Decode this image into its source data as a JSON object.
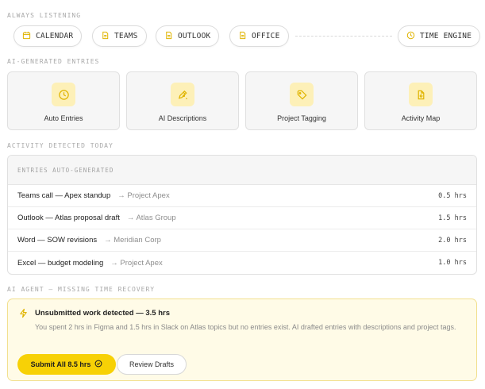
{
  "listening": {
    "label": "ALWAYS LISTENING",
    "chips": [
      {
        "label": "CALENDAR",
        "icon": "calendar-icon"
      },
      {
        "label": "TEAMS",
        "icon": "document-icon"
      },
      {
        "label": "OUTLOOK",
        "icon": "document-icon"
      },
      {
        "label": "OFFICE",
        "icon": "document-icon"
      }
    ],
    "engine": {
      "label": "TIME ENGINE",
      "icon": "clock-icon"
    }
  },
  "ai_entries": {
    "label": "AI-GENERATED ENTRIES",
    "cards": [
      {
        "label": "Auto Entries",
        "icon": "clock-icon"
      },
      {
        "label": "AI Descriptions",
        "icon": "pen-icon"
      },
      {
        "label": "Project Tagging",
        "icon": "tag-icon"
      },
      {
        "label": "Activity Map",
        "icon": "map-pin-icon"
      }
    ]
  },
  "activity": {
    "label": "ACTIVITY DETECTED TODAY",
    "table_header": "ENTRIES AUTO-GENERATED",
    "rows": [
      {
        "title": "Teams call — Apex standup",
        "project": "→ Project Apex",
        "hours": "0.5 hrs"
      },
      {
        "title": "Outlook — Atlas proposal draft",
        "project": "→ Atlas Group",
        "hours": "1.5 hrs"
      },
      {
        "title": "Word — SOW revisions",
        "project": "→ Meridian Corp",
        "hours": "2.0 hrs"
      },
      {
        "title": "Excel — budget modeling",
        "project": "→ Project Apex",
        "hours": "1.0 hrs"
      }
    ]
  },
  "agent": {
    "label": "AI AGENT — MISSING TIME RECOVERY",
    "title": "Unsubmitted work detected — 3.5 hrs",
    "description": "You spent 2 hrs in Figma and 1.5 hrs in Slack on Atlas topics but no entries exist. AI drafted entries with descriptions and project tags.",
    "primary_button": "Submit All 8.5 hrs",
    "secondary_button": "Review Drafts",
    "icon": "bolt-icon"
  },
  "colors": {
    "accent": "#f7d106",
    "accent_soft": "#fdf0b8",
    "icon_stroke": "#e0b400",
    "panel_bg": "#fffbe7"
  }
}
